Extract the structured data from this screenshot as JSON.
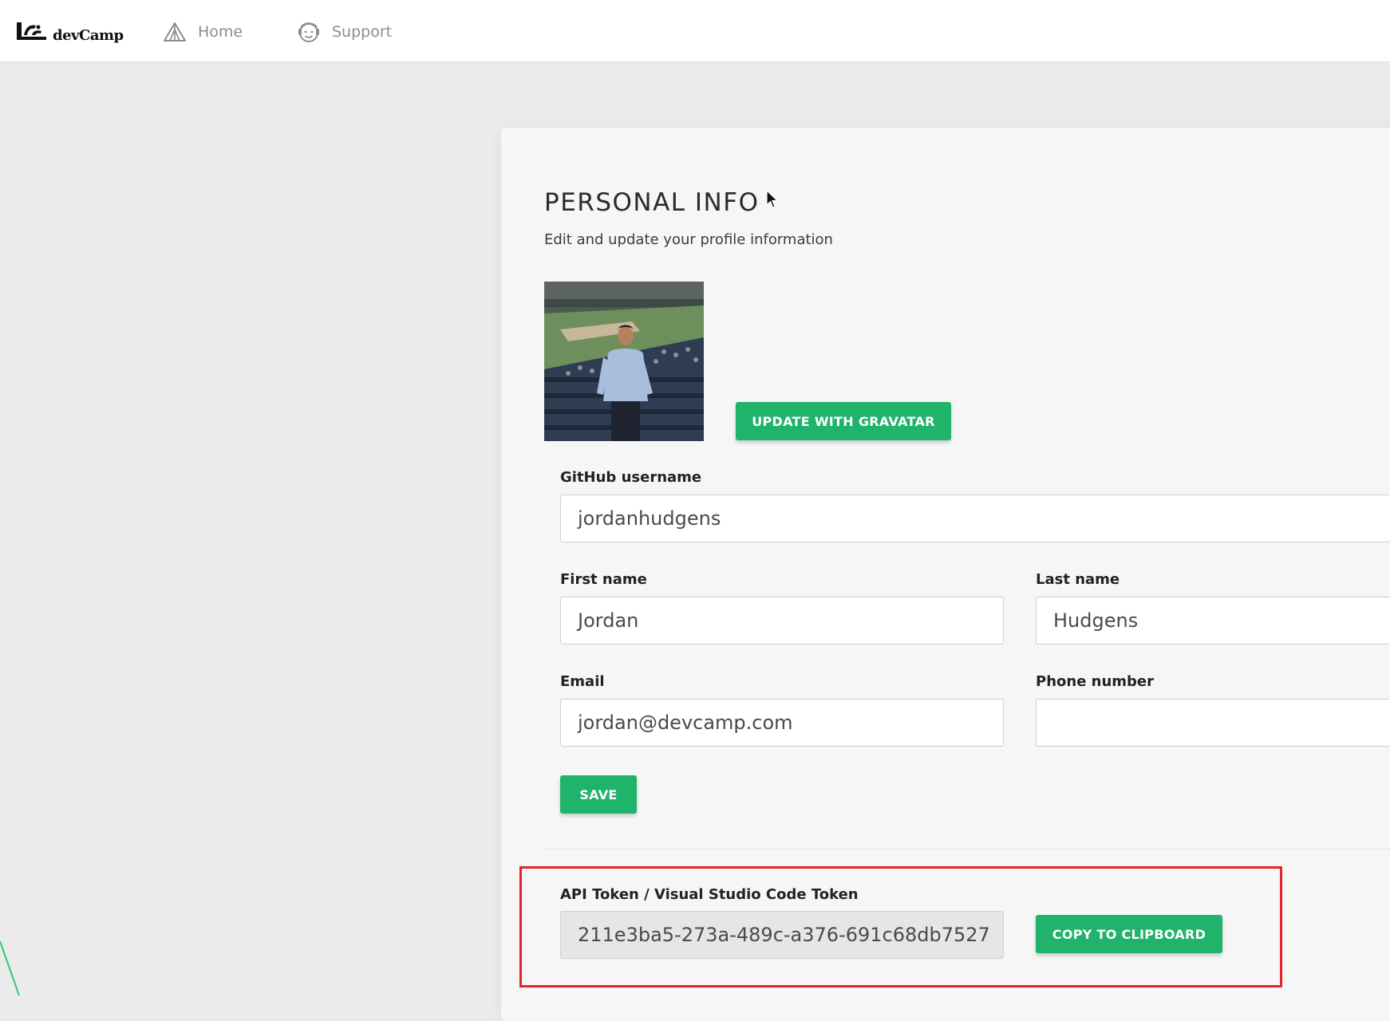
{
  "brand": {
    "name": "devCamp"
  },
  "nav": {
    "items": [
      {
        "label": "Home",
        "icon": "tent-icon"
      },
      {
        "label": "Support",
        "icon": "support-face-icon"
      }
    ]
  },
  "profile": {
    "title": "PERSONAL INFO",
    "subtitle": "Edit and update your profile information",
    "gravatar_button": "UPDATE WITH GRAVATAR",
    "save_button": "SAVE"
  },
  "fields": {
    "github": {
      "label": "GitHub username",
      "value": "jordanhudgens"
    },
    "first_name": {
      "label": "First name",
      "value": "Jordan"
    },
    "last_name": {
      "label": "Last name",
      "value": "Hudgens"
    },
    "email": {
      "label": "Email",
      "value": "jordan@devcamp.com"
    },
    "phone": {
      "label": "Phone number",
      "value": ""
    }
  },
  "api_token": {
    "label": "API Token / Visual Studio Code Token",
    "value": "211e3ba5-273a-489c-a376-691c68db7527",
    "copy_button": "COPY TO CLIPBOARD"
  },
  "colors": {
    "accent": "#1fb36c",
    "highlight_border": "#e3242b"
  }
}
